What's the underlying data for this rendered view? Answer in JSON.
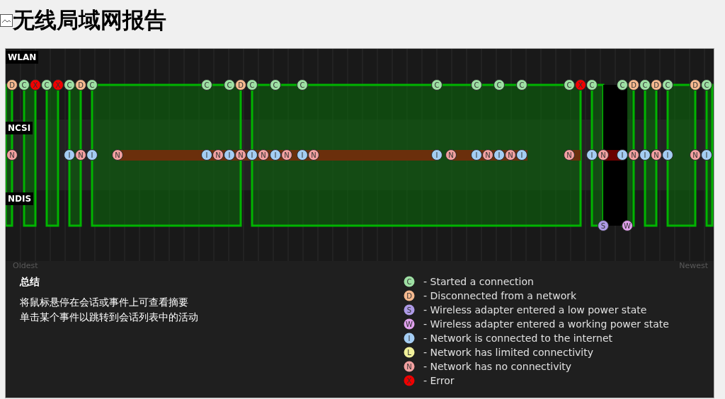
{
  "title": "无线局域网报告",
  "chart": {
    "rows": [
      {
        "label": "WLAN"
      },
      {
        "label": "NCSI"
      },
      {
        "label": "NDIS"
      }
    ],
    "wlan_events": [
      {
        "kind": "disconnect",
        "label": "D"
      },
      {
        "kind": "connect",
        "label": "C"
      },
      {
        "kind": "error",
        "label": "X"
      },
      {
        "kind": "connect",
        "label": "C"
      },
      {
        "kind": "error",
        "label": "X"
      },
      {
        "kind": "connect",
        "label": "C"
      },
      {
        "kind": "disconnect",
        "label": "D"
      },
      {
        "kind": "connect",
        "label": "C"
      },
      {
        "kind": "connect",
        "label": "C"
      },
      {
        "kind": "connect",
        "label": "C"
      },
      {
        "kind": "disconnect",
        "label": "D"
      },
      {
        "kind": "connect",
        "label": "C"
      },
      {
        "kind": "connect",
        "label": "C"
      },
      {
        "kind": "connect",
        "label": "C"
      },
      {
        "kind": "connect",
        "label": "C"
      },
      {
        "kind": "connect",
        "label": "C"
      },
      {
        "kind": "connect",
        "label": "C"
      },
      {
        "kind": "connect",
        "label": "C"
      },
      {
        "kind": "connect",
        "label": "C"
      },
      {
        "kind": "error",
        "label": "X"
      },
      {
        "kind": "connect",
        "label": "C"
      },
      {
        "kind": "connect",
        "label": "C"
      },
      {
        "kind": "disconnect",
        "label": "D"
      },
      {
        "kind": "connect",
        "label": "C"
      },
      {
        "kind": "disconnect",
        "label": "D"
      },
      {
        "kind": "connect",
        "label": "C"
      },
      {
        "kind": "disconnect",
        "label": "D"
      },
      {
        "kind": "connect",
        "label": "C"
      }
    ],
    "ncsi_events": [
      {
        "kind": "no-connectivity",
        "label": "N"
      },
      {
        "kind": "internet",
        "label": "I"
      },
      {
        "kind": "no-connectivity",
        "label": "N"
      },
      {
        "kind": "internet",
        "label": "I"
      },
      {
        "kind": "no-connectivity",
        "label": "N"
      },
      {
        "kind": "internet",
        "label": "I"
      },
      {
        "kind": "no-connectivity",
        "label": "N"
      },
      {
        "kind": "internet",
        "label": "I"
      },
      {
        "kind": "no-connectivity",
        "label": "N"
      },
      {
        "kind": "internet",
        "label": "I"
      },
      {
        "kind": "no-connectivity",
        "label": "N"
      },
      {
        "kind": "internet",
        "label": "I"
      },
      {
        "kind": "no-connectivity",
        "label": "N"
      },
      {
        "kind": "internet",
        "label": "I"
      },
      {
        "kind": "no-connectivity",
        "label": "N"
      },
      {
        "kind": "internet",
        "label": "I"
      },
      {
        "kind": "no-connectivity",
        "label": "N"
      },
      {
        "kind": "internet",
        "label": "I"
      },
      {
        "kind": "no-connectivity",
        "label": "N"
      },
      {
        "kind": "internet",
        "label": "I"
      },
      {
        "kind": "no-connectivity",
        "label": "N"
      },
      {
        "kind": "internet",
        "label": "I"
      },
      {
        "kind": "no-connectivity",
        "label": "N"
      },
      {
        "kind": "internet",
        "label": "I"
      },
      {
        "kind": "no-connectivity",
        "label": "N"
      },
      {
        "kind": "internet",
        "label": "I"
      },
      {
        "kind": "no-connectivity",
        "label": "N"
      },
      {
        "kind": "internet",
        "label": "I"
      },
      {
        "kind": "no-connectivity",
        "label": "N"
      },
      {
        "kind": "internet",
        "label": "I"
      },
      {
        "kind": "no-connectivity",
        "label": "N"
      },
      {
        "kind": "internet",
        "label": "I"
      }
    ],
    "ndis_events": [
      {
        "kind": "sleep",
        "label": "S"
      },
      {
        "kind": "wake",
        "label": "W"
      }
    ],
    "axis_start": "Oldest",
    "axis_end": "Newest"
  },
  "summary": {
    "heading": "总结",
    "lines": [
      "将鼠标悬停在会话或事件上可查看摘要",
      "单击某个事件以跳转到会话列表中的活动"
    ]
  },
  "legend": [
    {
      "kind": "connect",
      "label": "C",
      "text": "- Started a connection"
    },
    {
      "kind": "disconnect",
      "label": "D",
      "text": "- Disconnected from a network"
    },
    {
      "kind": "sleep",
      "label": "S",
      "text": "- Wireless adapter entered a low power state"
    },
    {
      "kind": "wake",
      "label": "W",
      "text": "- Wireless adapter entered a working power state"
    },
    {
      "kind": "internet",
      "label": "I",
      "text": "- Network is connected to the internet"
    },
    {
      "kind": "limited",
      "label": "L",
      "text": "- Network has limited connectivity"
    },
    {
      "kind": "no-connectivity",
      "label": "N",
      "text": "- Network has no connectivity"
    },
    {
      "kind": "error",
      "label": "X",
      "text": "- Error"
    }
  ]
}
